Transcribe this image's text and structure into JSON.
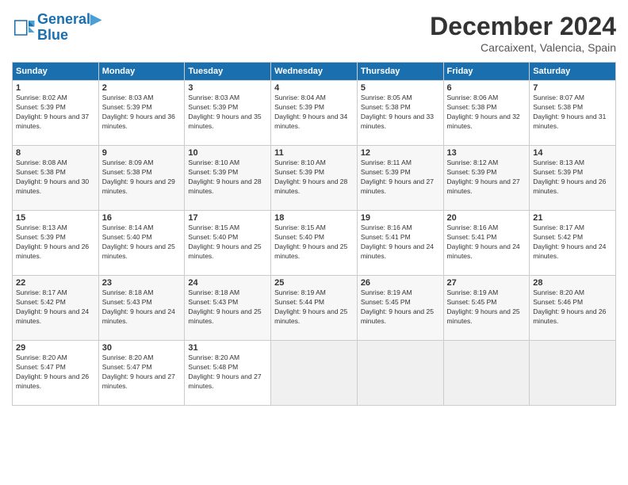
{
  "header": {
    "logo_line1": "General",
    "logo_line2": "Blue",
    "title": "December 2024",
    "location": "Carcaixent, Valencia, Spain"
  },
  "weekdays": [
    "Sunday",
    "Monday",
    "Tuesday",
    "Wednesday",
    "Thursday",
    "Friday",
    "Saturday"
  ],
  "weeks": [
    [
      {
        "day": "1",
        "sunrise": "Sunrise: 8:02 AM",
        "sunset": "Sunset: 5:39 PM",
        "daylight": "Daylight: 9 hours and 37 minutes."
      },
      {
        "day": "2",
        "sunrise": "Sunrise: 8:03 AM",
        "sunset": "Sunset: 5:39 PM",
        "daylight": "Daylight: 9 hours and 36 minutes."
      },
      {
        "day": "3",
        "sunrise": "Sunrise: 8:03 AM",
        "sunset": "Sunset: 5:39 PM",
        "daylight": "Daylight: 9 hours and 35 minutes."
      },
      {
        "day": "4",
        "sunrise": "Sunrise: 8:04 AM",
        "sunset": "Sunset: 5:39 PM",
        "daylight": "Daylight: 9 hours and 34 minutes."
      },
      {
        "day": "5",
        "sunrise": "Sunrise: 8:05 AM",
        "sunset": "Sunset: 5:38 PM",
        "daylight": "Daylight: 9 hours and 33 minutes."
      },
      {
        "day": "6",
        "sunrise": "Sunrise: 8:06 AM",
        "sunset": "Sunset: 5:38 PM",
        "daylight": "Daylight: 9 hours and 32 minutes."
      },
      {
        "day": "7",
        "sunrise": "Sunrise: 8:07 AM",
        "sunset": "Sunset: 5:38 PM",
        "daylight": "Daylight: 9 hours and 31 minutes."
      }
    ],
    [
      {
        "day": "8",
        "sunrise": "Sunrise: 8:08 AM",
        "sunset": "Sunset: 5:38 PM",
        "daylight": "Daylight: 9 hours and 30 minutes."
      },
      {
        "day": "9",
        "sunrise": "Sunrise: 8:09 AM",
        "sunset": "Sunset: 5:38 PM",
        "daylight": "Daylight: 9 hours and 29 minutes."
      },
      {
        "day": "10",
        "sunrise": "Sunrise: 8:10 AM",
        "sunset": "Sunset: 5:39 PM",
        "daylight": "Daylight: 9 hours and 28 minutes."
      },
      {
        "day": "11",
        "sunrise": "Sunrise: 8:10 AM",
        "sunset": "Sunset: 5:39 PM",
        "daylight": "Daylight: 9 hours and 28 minutes."
      },
      {
        "day": "12",
        "sunrise": "Sunrise: 8:11 AM",
        "sunset": "Sunset: 5:39 PM",
        "daylight": "Daylight: 9 hours and 27 minutes."
      },
      {
        "day": "13",
        "sunrise": "Sunrise: 8:12 AM",
        "sunset": "Sunset: 5:39 PM",
        "daylight": "Daylight: 9 hours and 27 minutes."
      },
      {
        "day": "14",
        "sunrise": "Sunrise: 8:13 AM",
        "sunset": "Sunset: 5:39 PM",
        "daylight": "Daylight: 9 hours and 26 minutes."
      }
    ],
    [
      {
        "day": "15",
        "sunrise": "Sunrise: 8:13 AM",
        "sunset": "Sunset: 5:39 PM",
        "daylight": "Daylight: 9 hours and 26 minutes."
      },
      {
        "day": "16",
        "sunrise": "Sunrise: 8:14 AM",
        "sunset": "Sunset: 5:40 PM",
        "daylight": "Daylight: 9 hours and 25 minutes."
      },
      {
        "day": "17",
        "sunrise": "Sunrise: 8:15 AM",
        "sunset": "Sunset: 5:40 PM",
        "daylight": "Daylight: 9 hours and 25 minutes."
      },
      {
        "day": "18",
        "sunrise": "Sunrise: 8:15 AM",
        "sunset": "Sunset: 5:40 PM",
        "daylight": "Daylight: 9 hours and 25 minutes."
      },
      {
        "day": "19",
        "sunrise": "Sunrise: 8:16 AM",
        "sunset": "Sunset: 5:41 PM",
        "daylight": "Daylight: 9 hours and 24 minutes."
      },
      {
        "day": "20",
        "sunrise": "Sunrise: 8:16 AM",
        "sunset": "Sunset: 5:41 PM",
        "daylight": "Daylight: 9 hours and 24 minutes."
      },
      {
        "day": "21",
        "sunrise": "Sunrise: 8:17 AM",
        "sunset": "Sunset: 5:42 PM",
        "daylight": "Daylight: 9 hours and 24 minutes."
      }
    ],
    [
      {
        "day": "22",
        "sunrise": "Sunrise: 8:17 AM",
        "sunset": "Sunset: 5:42 PM",
        "daylight": "Daylight: 9 hours and 24 minutes."
      },
      {
        "day": "23",
        "sunrise": "Sunrise: 8:18 AM",
        "sunset": "Sunset: 5:43 PM",
        "daylight": "Daylight: 9 hours and 24 minutes."
      },
      {
        "day": "24",
        "sunrise": "Sunrise: 8:18 AM",
        "sunset": "Sunset: 5:43 PM",
        "daylight": "Daylight: 9 hours and 25 minutes."
      },
      {
        "day": "25",
        "sunrise": "Sunrise: 8:19 AM",
        "sunset": "Sunset: 5:44 PM",
        "daylight": "Daylight: 9 hours and 25 minutes."
      },
      {
        "day": "26",
        "sunrise": "Sunrise: 8:19 AM",
        "sunset": "Sunset: 5:45 PM",
        "daylight": "Daylight: 9 hours and 25 minutes."
      },
      {
        "day": "27",
        "sunrise": "Sunrise: 8:19 AM",
        "sunset": "Sunset: 5:45 PM",
        "daylight": "Daylight: 9 hours and 25 minutes."
      },
      {
        "day": "28",
        "sunrise": "Sunrise: 8:20 AM",
        "sunset": "Sunset: 5:46 PM",
        "daylight": "Daylight: 9 hours and 26 minutes."
      }
    ],
    [
      {
        "day": "29",
        "sunrise": "Sunrise: 8:20 AM",
        "sunset": "Sunset: 5:47 PM",
        "daylight": "Daylight: 9 hours and 26 minutes."
      },
      {
        "day": "30",
        "sunrise": "Sunrise: 8:20 AM",
        "sunset": "Sunset: 5:47 PM",
        "daylight": "Daylight: 9 hours and 27 minutes."
      },
      {
        "day": "31",
        "sunrise": "Sunrise: 8:20 AM",
        "sunset": "Sunset: 5:48 PM",
        "daylight": "Daylight: 9 hours and 27 minutes."
      },
      null,
      null,
      null,
      null
    ]
  ]
}
